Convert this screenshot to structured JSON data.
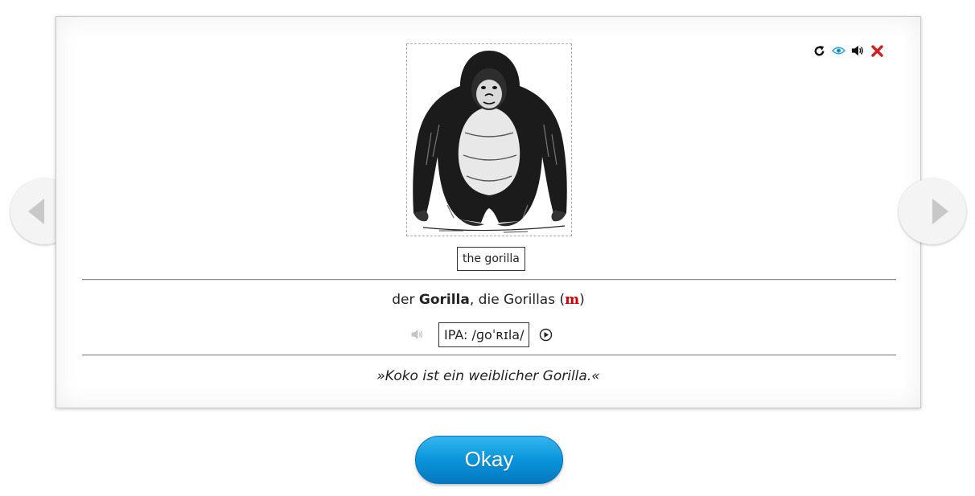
{
  "card": {
    "translation": "the gorilla",
    "word": {
      "article": "der",
      "noun": "Gorilla",
      "plural": ", die Gorillas",
      "gender_open": "(",
      "gender": "m",
      "gender_close": ")"
    },
    "ipa": "IPA: /ɡoˈʀɪla/",
    "example": "»Koko ist ein weiblicher Gorilla.«",
    "image_icon": "gorilla-illustration"
  },
  "toolbar": {
    "icons": [
      "refresh-icon",
      "eye-icon",
      "speaker-icon",
      "close-icon"
    ]
  },
  "navigation": {
    "prev_icon": "triangle-left-icon",
    "next_icon": "triangle-right-icon"
  },
  "actions": {
    "okay_label": "Okay"
  },
  "colors": {
    "gender": "#cc0000",
    "button": "#0a96dc",
    "eye_icon": "#2aa6dc",
    "close_icon": "#d02020"
  }
}
